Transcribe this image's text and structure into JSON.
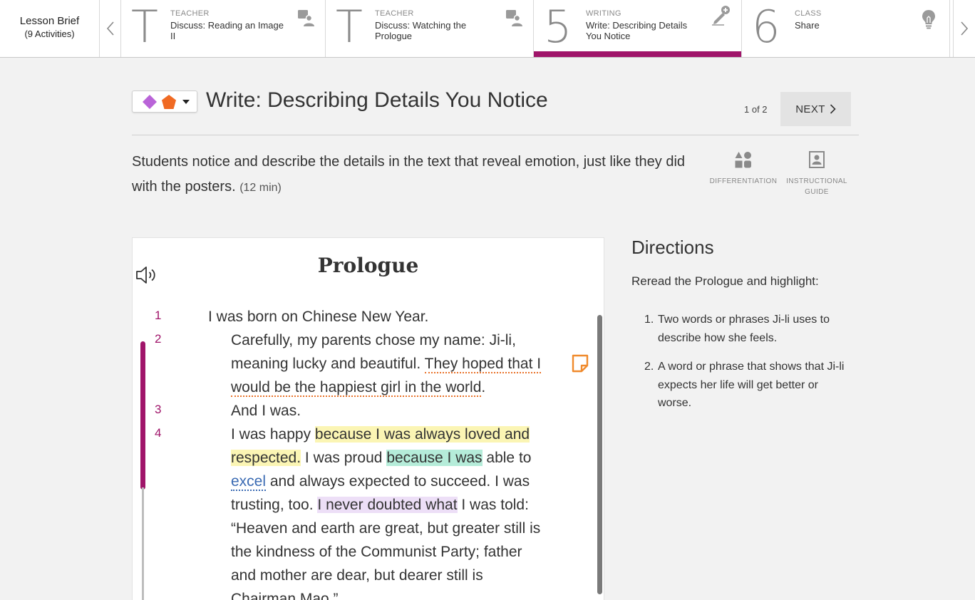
{
  "lesson_brief": {
    "title": "Lesson Brief",
    "count": "(9 Activities)"
  },
  "nav_tabs": [
    {
      "marker": "T",
      "kind": "TEACHER",
      "name": "Discuss: Reading an Image II",
      "icon": "teacher-presenter-icon"
    },
    {
      "marker": "T",
      "kind": "TEACHER",
      "name": "Discuss: Watching the Prologue",
      "icon": "teacher-presenter-icon"
    },
    {
      "marker": "5",
      "kind": "WRITING",
      "name": "Write: Describing Details You Notice",
      "icon": "pencil-add-icon",
      "active": true
    },
    {
      "marker": "6",
      "kind": "CLASS",
      "name": "Share",
      "icon": "lightbulb-icon"
    }
  ],
  "activity": {
    "title": "Write: Describing Details You Notice",
    "page_count": "1 of 2",
    "next_label": "NEXT",
    "description": "Students notice and describe the details in the text that reveal emotion, just like they did with the posters.",
    "duration": "(12 min)"
  },
  "tools": {
    "differentiation": "DIFFERENTIATION",
    "instructional_guide": "INSTRUCTIONAL GUIDE"
  },
  "text": {
    "title": "Prologue",
    "line_numbers": [
      "1",
      "2",
      "3",
      "4"
    ],
    "p1": "I was born on Chinese New Year.",
    "p2_a": "Carefully, my parents chose my name: Ji-li, meaning lucky and beautiful.",
    "p2_b": "They hoped that I would be the happiest girl in the world",
    "p2_c": ".",
    "p3": "And I was.",
    "p4_a": "I was happy",
    "p4_b": "because I was always loved and respected.",
    "p4_c": "I was proud",
    "p4_d": "because I was",
    "p4_e": "able to",
    "p4_f": "excel",
    "p4_g": "and always expected to succeed. I was trusting, too.",
    "p4_h": "I never doubted what",
    "p4_i": "I was told: “Heaven and earth are great, but greater still is the kindness of the Communist Party; father and mother are dear, but dearer still is Chairman Mao.”"
  },
  "directions": {
    "title": "Directions",
    "intro": "Reread the Prologue and highlight:",
    "items": [
      {
        "num": "1.",
        "text": "Two words or phrases Ji-li uses to describe how she feels."
      },
      {
        "num": "2.",
        "text": "A word or phrase that shows that Ji-li expects her life will get better or worse."
      }
    ]
  },
  "colors": {
    "accent": "#a0156a",
    "highlight_orange": "#e9732b",
    "highlight_yellow": "#fbf5b4",
    "highlight_teal": "#b5ecd9",
    "highlight_purple": "#eddff7",
    "color_purple_diamond": "#b964d8",
    "color_orange_pentagon": "#f06a23",
    "vocab_link": "#3b6bb3"
  }
}
